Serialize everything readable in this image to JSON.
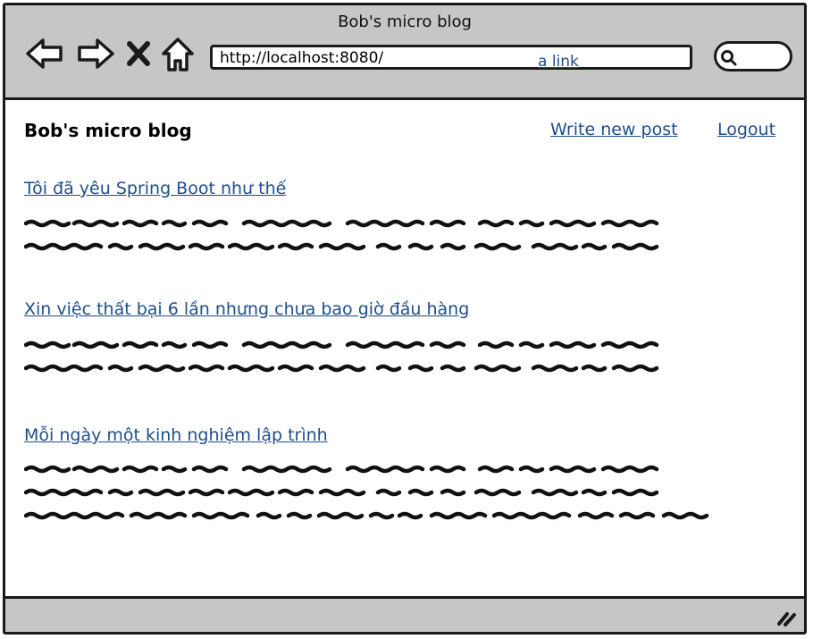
{
  "window": {
    "title": "Bob's micro blog"
  },
  "browser": {
    "url": "http://localhost:8080/",
    "url_link": "a link",
    "icons": [
      "back-icon",
      "forward-icon",
      "close-icon",
      "home-icon",
      "search-icon"
    ]
  },
  "header": {
    "brand": "Bob's micro blog",
    "write_link": "Write new post",
    "logout_link": "Logout"
  },
  "posts": [
    {
      "title": "Tôi đã yêu Spring Boot như thế ",
      "body_lines": 2
    },
    {
      "title": "Xin việc thất bại 6 lần nhưng chưa bao giờ đầu hàng",
      "body_lines": 2
    },
    {
      "title": "Mỗi ngày một kinh nghiệm lập trình",
      "body_lines": 3
    }
  ]
}
